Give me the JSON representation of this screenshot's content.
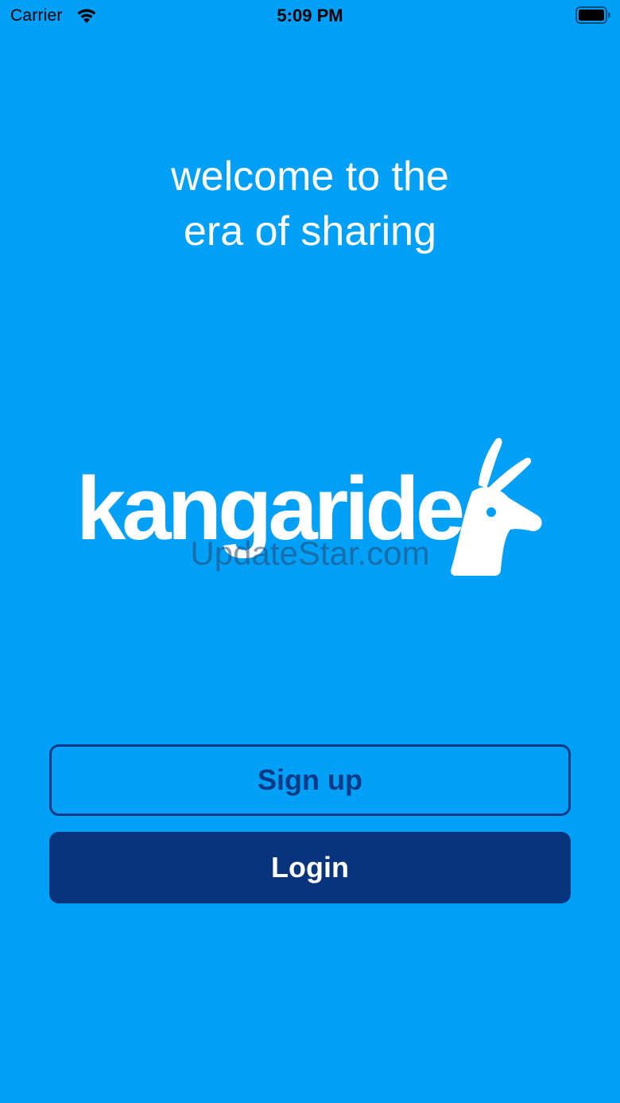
{
  "status_bar": {
    "carrier": "Carrier",
    "time": "5:09 PM",
    "wifi_icon": "wifi-icon",
    "battery_icon": "battery-full-icon"
  },
  "welcome": {
    "line1": "welcome to the",
    "line2": "era of sharing"
  },
  "logo": {
    "text": "kangaride",
    "mark_icon": "kangaroo-head-icon"
  },
  "watermark": "UpdateStar.com",
  "buttons": {
    "signup_label": "Sign up",
    "login_label": "Login"
  },
  "colors": {
    "background": "#03a0f7",
    "primary_dark": "#07347d",
    "outline": "#0a3a86",
    "text_light": "#ffffff"
  }
}
